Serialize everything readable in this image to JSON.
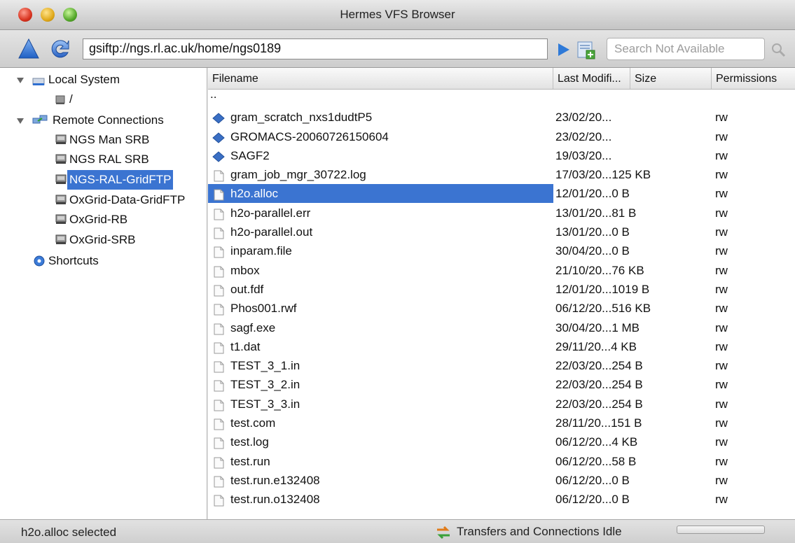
{
  "window": {
    "title": "Hermes VFS Browser"
  },
  "toolbar": {
    "address": "gsiftp://ngs.rl.ac.uk/home/ngs0189",
    "search_placeholder": "Search Not Available"
  },
  "sidebar": {
    "local": {
      "label": "Local System",
      "root": "/"
    },
    "remote": {
      "label": "Remote Connections",
      "items": [
        "NGS Man SRB",
        "NGS RAL SRB",
        "NGS-RAL-GridFTP",
        "OxGrid-Data-GridFTP",
        "OxGrid-RB",
        "OxGrid-SRB"
      ],
      "selected": "NGS-RAL-GridFTP"
    },
    "shortcuts": "Shortcuts"
  },
  "table": {
    "headers": [
      "Filename",
      "Last Modifi...",
      "Size",
      "Permissions"
    ],
    "rows": [
      {
        "name": "..",
        "date": "",
        "perm": "",
        "type": "parent"
      },
      {
        "name": "gram_scratch_nxs1dudtP5",
        "date": "23/02/20...",
        "perm": "rw",
        "type": "folder"
      },
      {
        "name": "GROMACS-20060726150604",
        "date": "23/02/20...",
        "perm": "rw",
        "type": "folder"
      },
      {
        "name": "SAGF2",
        "date": "19/03/20...",
        "perm": "rw",
        "type": "folder"
      },
      {
        "name": "gram_job_mgr_30722.log",
        "date": "17/03/20...125  KB",
        "perm": "rw",
        "type": "file"
      },
      {
        "name": "h2o.alloc",
        "date": "12/01/20...0 B",
        "perm": "rw",
        "type": "file",
        "selected": true
      },
      {
        "name": "h2o-parallel.err",
        "date": "13/01/20...81 B",
        "perm": "rw",
        "type": "file"
      },
      {
        "name": "h2o-parallel.out",
        "date": "13/01/20...0 B",
        "perm": "rw",
        "type": "file"
      },
      {
        "name": "inparam.file",
        "date": "30/04/20...0 B",
        "perm": "rw",
        "type": "file"
      },
      {
        "name": "mbox",
        "date": "21/10/20...76  KB",
        "perm": "rw",
        "type": "file"
      },
      {
        "name": "out.fdf",
        "date": "12/01/20...1019 B",
        "perm": "rw",
        "type": "file"
      },
      {
        "name": "Phos001.rwf",
        "date": "06/12/20...516  KB",
        "perm": "rw",
        "type": "file"
      },
      {
        "name": "sagf.exe",
        "date": "30/04/20...1  MB",
        "perm": "rw",
        "type": "file"
      },
      {
        "name": "t1.dat",
        "date": "29/11/20...4  KB",
        "perm": "rw",
        "type": "file"
      },
      {
        "name": "TEST_3_1.in",
        "date": "22/03/20...254 B",
        "perm": "rw",
        "type": "file"
      },
      {
        "name": "TEST_3_2.in",
        "date": "22/03/20...254 B",
        "perm": "rw",
        "type": "file"
      },
      {
        "name": "TEST_3_3.in",
        "date": "22/03/20...254 B",
        "perm": "rw",
        "type": "file"
      },
      {
        "name": "test.com",
        "date": "28/11/20...151 B",
        "perm": "rw",
        "type": "file"
      },
      {
        "name": "test.log",
        "date": "06/12/20...4  KB",
        "perm": "rw",
        "type": "file"
      },
      {
        "name": "test.run",
        "date": "06/12/20...58 B",
        "perm": "rw",
        "type": "file"
      },
      {
        "name": "test.run.e132408",
        "date": "06/12/20...0 B",
        "perm": "rw",
        "type": "file"
      },
      {
        "name": "test.run.o132408",
        "date": "06/12/20...0 B",
        "perm": "rw",
        "type": "file"
      }
    ]
  },
  "status": {
    "left": "h2o.alloc selected",
    "right": "Transfers and Connections Idle"
  },
  "colors": {
    "selection": "#3b74d1",
    "folder_icon": "#3a6fc4"
  }
}
